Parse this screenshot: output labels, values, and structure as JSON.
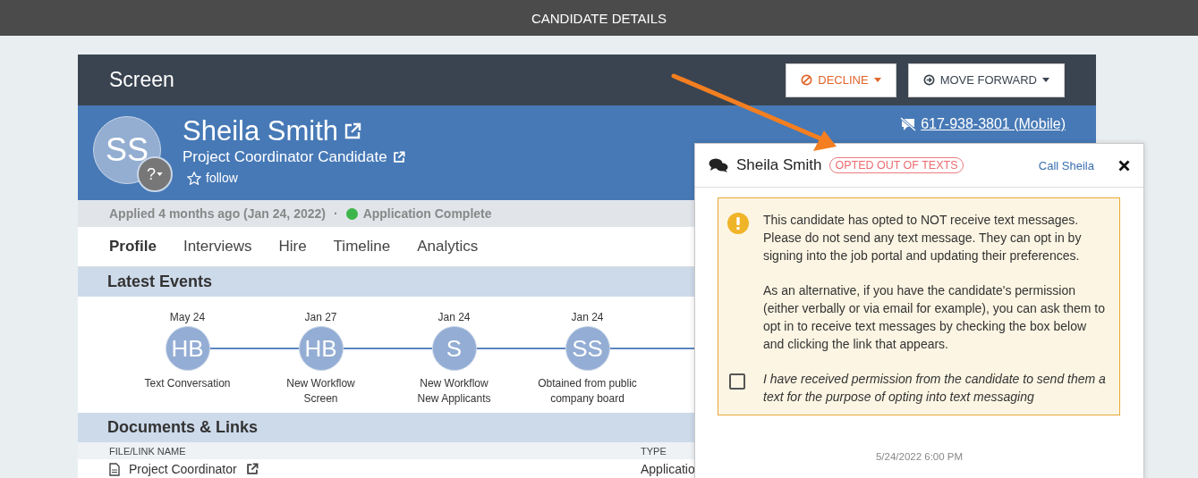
{
  "top_bar": {
    "title": "CANDIDATE DETAILS"
  },
  "stage": {
    "title": "Screen",
    "buttons": [
      {
        "label": "DECLINE",
        "kind": "decline"
      },
      {
        "label": "MOVE FORWARD",
        "kind": "forward"
      }
    ]
  },
  "candidate": {
    "initials": "SS",
    "badge": "?",
    "name": "Sheila Smith",
    "role": "Project Coordinator Candidate",
    "follow": "follow",
    "phones": [
      {
        "number": "617-938-3801 (Mobile)"
      }
    ]
  },
  "status": {
    "applied": "Applied 4 months ago (Jan 24, 2022)",
    "separator": "·",
    "state": "Application Complete",
    "color": "#3cb54a"
  },
  "tabs": [
    {
      "label": "Profile",
      "selected": true
    },
    {
      "label": "Interviews",
      "selected": false
    },
    {
      "label": "Hire",
      "selected": false
    },
    {
      "label": "Timeline",
      "selected": false
    },
    {
      "label": "Analytics",
      "selected": false
    }
  ],
  "latest_events": {
    "title": "Latest Events",
    "events": [
      {
        "date": "May 24",
        "initials": "HB",
        "lines": [
          "Text Conversation"
        ]
      },
      {
        "date": "Jan 27",
        "initials": "HB",
        "lines": [
          "New Workflow",
          "Screen"
        ]
      },
      {
        "date": "Jan 24",
        "initials": "S",
        "lines": [
          "New Workflow",
          "New Applicants"
        ]
      },
      {
        "date": "Jan 24",
        "initials": "SS",
        "lines": [
          "Obtained from public",
          "company board"
        ]
      }
    ]
  },
  "documents": {
    "title": "Documents & Links",
    "columns": [
      "FILE/LINK NAME",
      "TYPE"
    ],
    "rows": [
      {
        "name": "Project Coordinator",
        "type": "Applicatio"
      }
    ]
  },
  "text_panel": {
    "name": "Sheila Smith",
    "badge": "OPTED OUT OF TEXTS",
    "call": "Call Sheila",
    "warning": [
      "This candidate has opted to NOT receive text messages. Please do not send any text message. They can opt in by signing into the job portal and updating their preferences.",
      "As an alternative, if you have the candidate's permission (either verbally or via email for example), you can ask them to opt in to receive text messages by checking the box below and clicking the link that appears."
    ],
    "permission": {
      "label": "I have received permission from the candidate to send them a text for the purpose of opting into text messaging",
      "checked": false
    },
    "timestamp": "5/24/2022 6:00 PM"
  }
}
